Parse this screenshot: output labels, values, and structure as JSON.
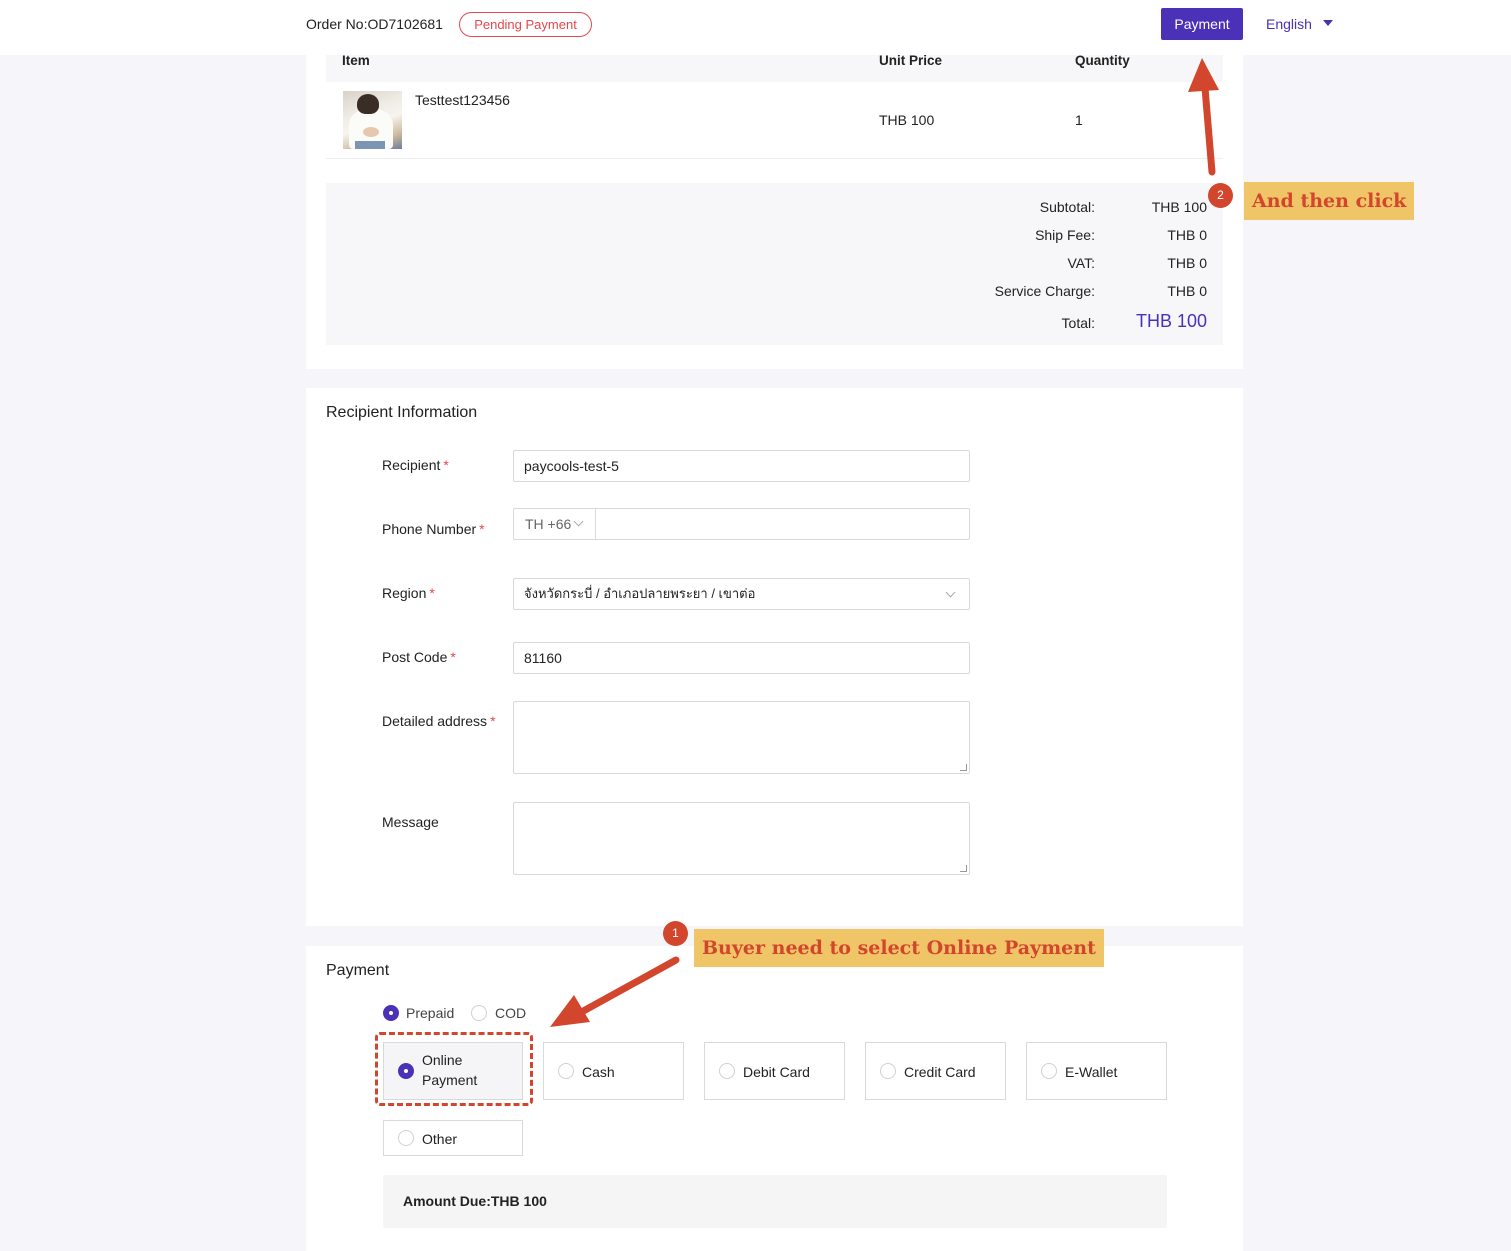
{
  "header": {
    "order_no": "Order No:OD7102681",
    "status": "Pending Payment",
    "payment_button": "Payment",
    "language": "English"
  },
  "order": {
    "columns": {
      "item": "Item",
      "unit_price": "Unit Price",
      "quantity": "Quantity"
    },
    "items": [
      {
        "name": "Testtest123456",
        "unit_price": "THB 100",
        "quantity": "1"
      }
    ],
    "summary": {
      "subtotal_label": "Subtotal:",
      "subtotal": "THB 100",
      "ship_label": "Ship Fee:",
      "ship": "THB 0",
      "vat_label": "VAT:",
      "vat": "THB 0",
      "service_label": "Service Charge:",
      "service": "THB 0",
      "total_label": "Total:",
      "total": "THB 100"
    }
  },
  "recipient": {
    "title": "Recipient Information",
    "recipient_label": "Recipient",
    "recipient_value": "paycools-test-5",
    "phone_label": "Phone Number",
    "phone_prefix": "TH +66",
    "phone_value": "",
    "region_label": "Region",
    "region_value": "จังหวัดกระบี่ / อำเภอปลายพระยา / เขาต่อ",
    "postcode_label": "Post Code",
    "postcode_value": "81160",
    "address_label": "Detailed address",
    "message_label": "Message",
    "required_mark": "*"
  },
  "payment": {
    "title": "Payment",
    "modes": [
      {
        "label": "Prepaid",
        "selected": true
      },
      {
        "label": "COD",
        "selected": false
      }
    ],
    "methods": [
      {
        "label": "Online Payment",
        "selected": true
      },
      {
        "label": "Cash",
        "selected": false
      },
      {
        "label": "Debit Card",
        "selected": false
      },
      {
        "label": "Credit Card",
        "selected": false
      },
      {
        "label": "E-Wallet",
        "selected": false
      },
      {
        "label": "Other",
        "selected": false
      }
    ],
    "amount_due": "Amount Due:THB 100"
  },
  "annotations": {
    "step1_number": "1",
    "step1_text": "Buyer need to select Online Payment",
    "step2_number": "2",
    "step2_text": "And then click",
    "color": "#d2462d",
    "callout_bg": "#f0c567"
  },
  "colors": {
    "accent": "#4a31b8",
    "danger": "#e5484d"
  }
}
